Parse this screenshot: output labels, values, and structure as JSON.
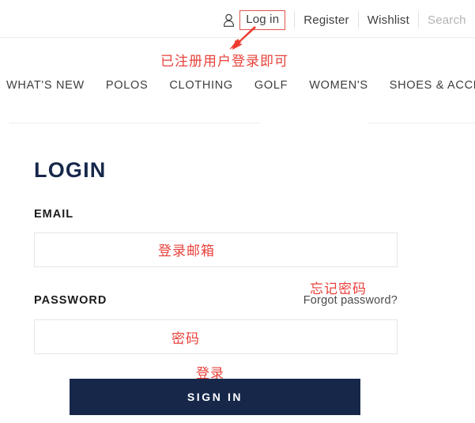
{
  "header": {
    "user_icon": "user-icon",
    "login_label": "Log in",
    "register_label": "Register",
    "wishlist_label": "Wishlist",
    "search_placeholder": "Search",
    "login_box_border_color": "#e0544b"
  },
  "nav": {
    "items": [
      {
        "label": "WHAT'S NEW"
      },
      {
        "label": "POLOS"
      },
      {
        "label": "CLOTHING"
      },
      {
        "label": "GOLF"
      },
      {
        "label": "WOMEN'S"
      },
      {
        "label": "SHOES & ACCESSORI"
      }
    ]
  },
  "form": {
    "title": "LOGIN",
    "email_label": "EMAIL",
    "email_value": "",
    "email_placeholder": "",
    "password_label": "PASSWORD",
    "password_value": "",
    "password_placeholder": "",
    "forgot_label": "Forgot password?",
    "submit_label": "SIGN IN",
    "submit_color": "#16274a"
  },
  "annotations": {
    "color": "#e8413a",
    "header_note": "已注册用户登录即可",
    "email_note": "登录邮箱",
    "password_note": "密码",
    "forgot_note": "忘记密码",
    "signin_note": "登录",
    "arrow": "arrow-up-right-icon"
  }
}
